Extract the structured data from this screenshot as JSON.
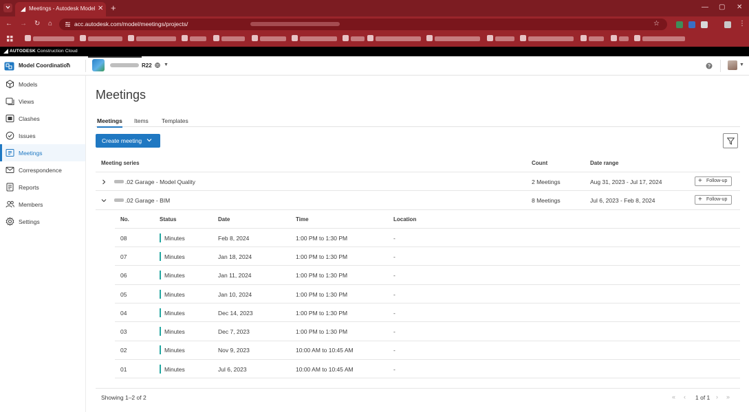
{
  "browser": {
    "tab_title": "Meetings - Autodesk Model Co",
    "url": "acc.autodesk.com/model/meetings/projects/"
  },
  "acc_bar": {
    "brand_bold": "AUTODESK",
    "brand_rest": " Construction Cloud"
  },
  "header": {
    "module": "Model Coordination",
    "project_suffix": "R22"
  },
  "sidebar": {
    "items": [
      {
        "label": "Models",
        "icon": "cube-icon"
      },
      {
        "label": "Views",
        "icon": "views-icon"
      },
      {
        "label": "Clashes",
        "icon": "clashes-icon"
      },
      {
        "label": "Issues",
        "icon": "issues-icon"
      },
      {
        "label": "Meetings",
        "icon": "meetings-icon"
      },
      {
        "label": "Correspondence",
        "icon": "mail-icon"
      },
      {
        "label": "Reports",
        "icon": "reports-icon"
      },
      {
        "label": "Members",
        "icon": "members-icon"
      },
      {
        "label": "Settings",
        "icon": "gear-icon"
      }
    ],
    "active": "Meetings",
    "accent": "#1f78c2"
  },
  "page": {
    "title": "Meetings",
    "tabs": [
      "Meetings",
      "Items",
      "Templates"
    ],
    "active_tab": "Meetings",
    "create_button": "Create meeting"
  },
  "table": {
    "headers": {
      "series": "Meeting series",
      "count": "Count",
      "range": "Date range"
    },
    "series": [
      {
        "name": ".02 Garage - Model Quality",
        "count": "2 Meetings",
        "range": "Aug 31, 2023 - Jul 17, 2024",
        "follow": "Follow-up",
        "expanded": false
      },
      {
        "name": ".02 Garage - BIM",
        "count": "8 Meetings",
        "range": "Jul 6, 2023 - Feb 8, 2024",
        "follow": "Follow-up",
        "expanded": true
      }
    ],
    "sub_headers": {
      "no": "No.",
      "status": "Status",
      "date": "Date",
      "time": "Time",
      "location": "Location"
    },
    "meetings": [
      {
        "no": "08",
        "status": "Minutes",
        "date": "Feb 8, 2024",
        "time": "1:00 PM to 1:30 PM",
        "location": "-"
      },
      {
        "no": "07",
        "status": "Minutes",
        "date": "Jan 18, 2024",
        "time": "1:00 PM to 1:30 PM",
        "location": "-"
      },
      {
        "no": "06",
        "status": "Minutes",
        "date": "Jan 11, 2024",
        "time": "1:00 PM to 1:30 PM",
        "location": "-"
      },
      {
        "no": "05",
        "status": "Minutes",
        "date": "Jan 10, 2024",
        "time": "1:00 PM to 1:30 PM",
        "location": "-"
      },
      {
        "no": "04",
        "status": "Minutes",
        "date": "Dec 14, 2023",
        "time": "1:00 PM to 1:30 PM",
        "location": "-"
      },
      {
        "no": "03",
        "status": "Minutes",
        "date": "Dec 7, 2023",
        "time": "1:00 PM to 1:30 PM",
        "location": "-"
      },
      {
        "no": "02",
        "status": "Minutes",
        "date": "Nov 9, 2023",
        "time": "10:00 AM to 10:45 AM",
        "location": "-"
      },
      {
        "no": "01",
        "status": "Minutes",
        "date": "Jul 6, 2023",
        "time": "10:00 AM to 10:45 AM",
        "location": "-"
      }
    ],
    "status_color": "#23a6a0"
  },
  "footer": {
    "showing": "Showing 1–2 of 2",
    "page_info": "1 of 1"
  }
}
